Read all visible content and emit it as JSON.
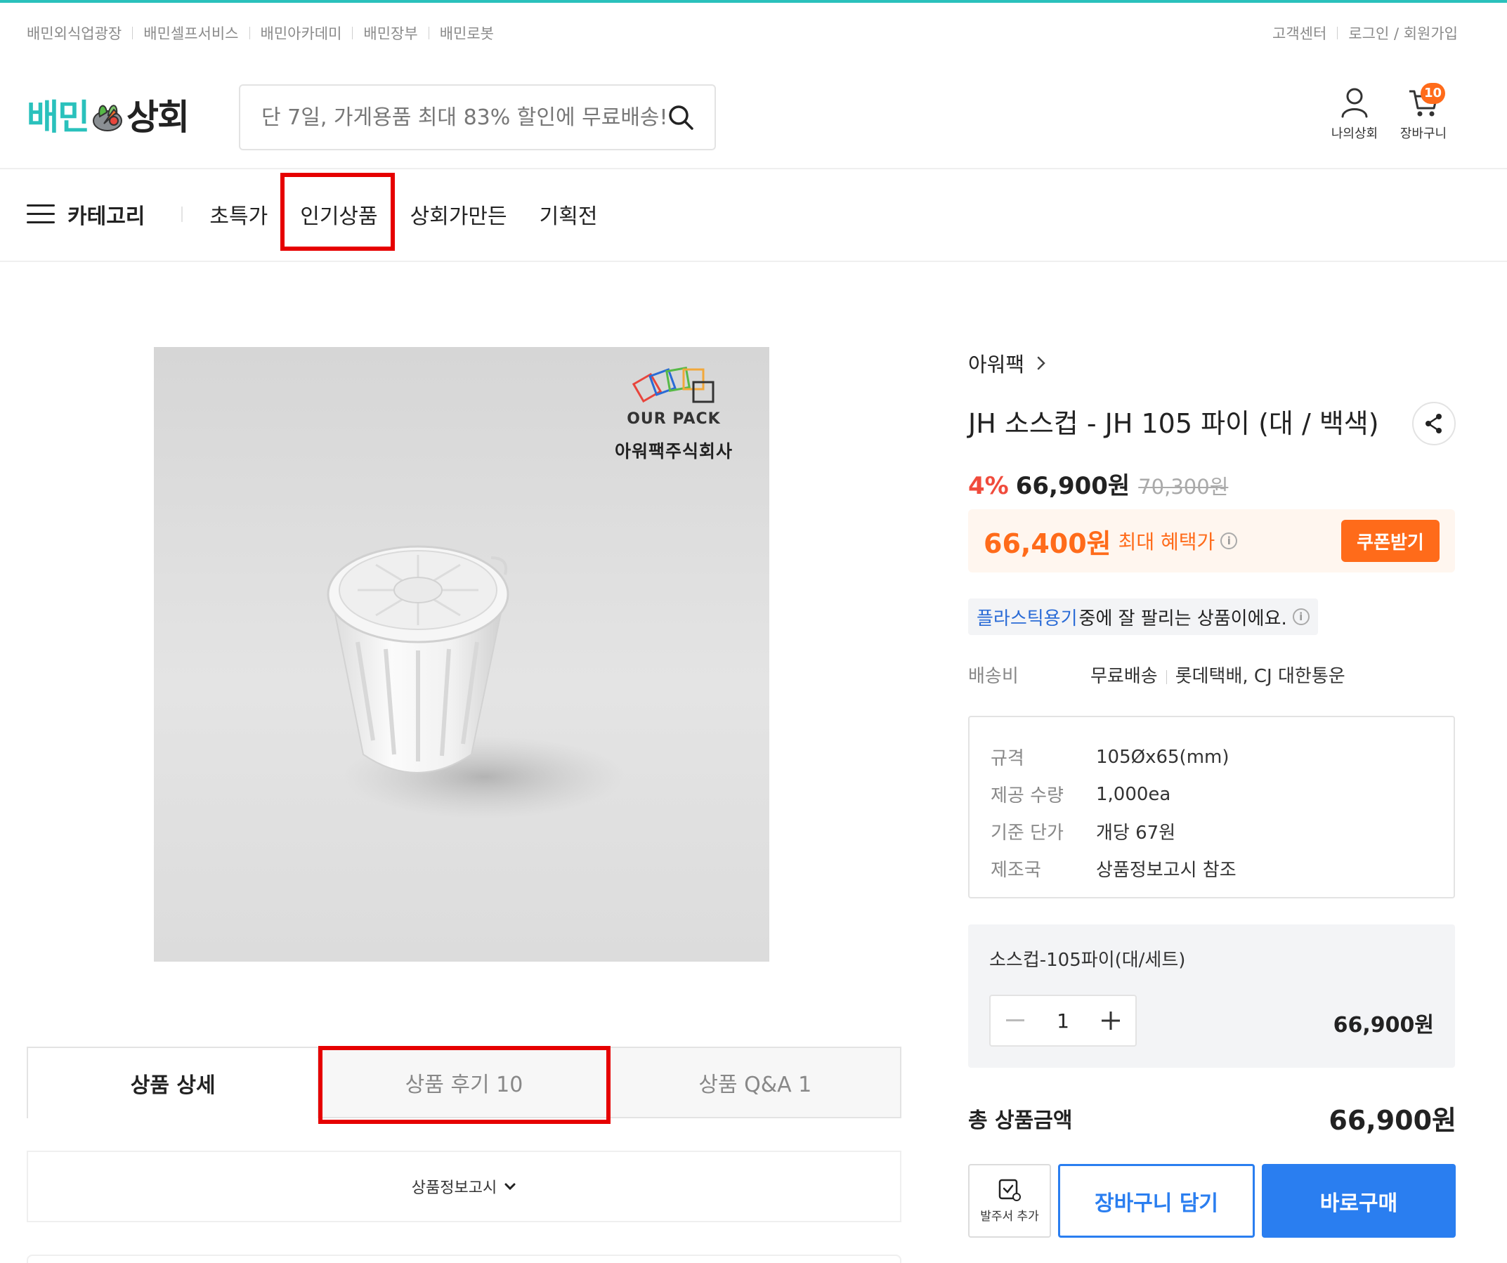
{
  "util_links": [
    "배민외식업광장",
    "배민셀프서비스",
    "배민아카데미",
    "배민장부",
    "배민로봇"
  ],
  "util_right": [
    "고객센터",
    "로그인 / 회원가입"
  ],
  "logo": {
    "part1": "배민",
    "part2": "상회"
  },
  "search": {
    "placeholder": "단 7일, 가게용품 최대 83% 할인에 무료배송!"
  },
  "header_icons": {
    "my_label": "나의상회",
    "cart_label": "장바구니",
    "cart_count": "10"
  },
  "nav": {
    "category_label": "카테고리",
    "items": [
      "초특가",
      "인기상품",
      "상회가만든",
      "기획전"
    ]
  },
  "product_image": {
    "brand_en": "OUR PACK",
    "brand_ko": "아워팩주식회사"
  },
  "tabs": [
    "상품 상세",
    "상품 후기 10",
    "상품 Q&A 1"
  ],
  "info_notice": "상품정보고시",
  "product": {
    "brand": "아워팩",
    "title": "JH 소스컵 - JH 105 파이 (대 / 백색)",
    "discount": "4%",
    "price": "66,900원",
    "original_price": "70,300원",
    "benefit_price": "66,400원",
    "benefit_label": "최대 혜택가",
    "coupon_label": "쿠폰받기",
    "popular_category": "플라스틱용기",
    "popular_text": "중에 잘 팔리는 상품이에요.",
    "shipping_label": "배송비",
    "shipping_value": "무료배송",
    "shipping_carrier": "롯데택배, CJ 대한통운",
    "specs": [
      {
        "label": "규격",
        "value": "105Øx65(mm)"
      },
      {
        "label": "제공 수량",
        "value": "1,000ea"
      },
      {
        "label": "기준 단가",
        "value": "개당 67원"
      },
      {
        "label": "제조국",
        "value": "상품정보고시 참조"
      }
    ],
    "option_name": "소스컵-105파이(대/세트)",
    "quantity": "1",
    "option_price": "66,900원",
    "total_label": "총 상품금액",
    "total_price": "66,900원",
    "order_add_label": "발주서 추가",
    "cart_button": "장바구니 담기",
    "buy_button": "바로구매"
  },
  "colors": {
    "brand_mint": "#2ac1bc",
    "accent_orange": "#ff6b1a",
    "action_blue": "#2a7ef0",
    "discount_red": "#f04b3c",
    "highlight_red": "#e60000"
  }
}
